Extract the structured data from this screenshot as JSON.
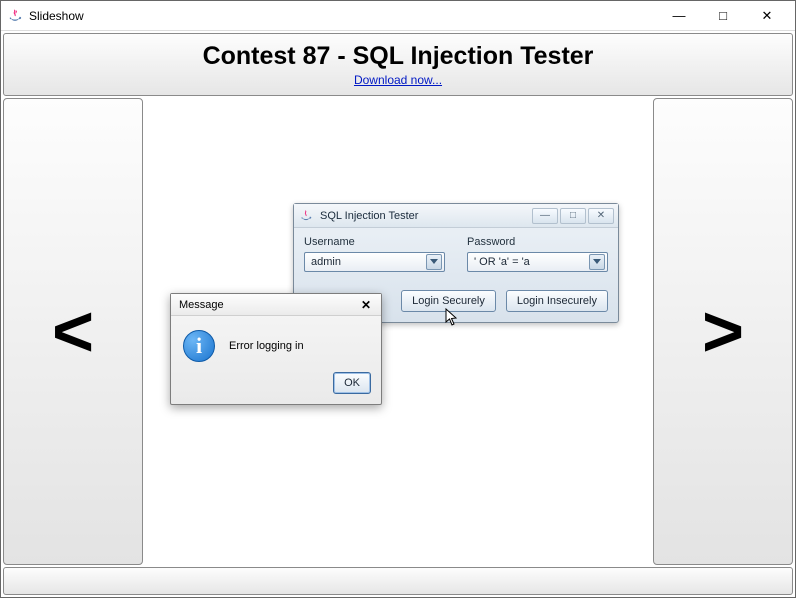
{
  "outer_window": {
    "title": "Slideshow",
    "minimize_glyph": "—",
    "maximize_glyph": "□",
    "close_glyph": "✕"
  },
  "header": {
    "title": "Contest 87 - SQL Injection Tester",
    "download_link": "Download now..."
  },
  "nav": {
    "prev_glyph": "<",
    "next_glyph": ">"
  },
  "sql_window": {
    "title": "SQL Injection Tester",
    "minimize_glyph": "—",
    "maximize_glyph": "□",
    "close_glyph": "✕",
    "username_label": "Username",
    "password_label": "Password",
    "username_value": "admin",
    "password_value": "' OR 'a' = 'a",
    "login_securely": "Login Securely",
    "login_insecurely": "Login Insecurely"
  },
  "message_dialog": {
    "title": "Message",
    "close_glyph": "✕",
    "body": "Error logging in",
    "ok": "OK"
  }
}
